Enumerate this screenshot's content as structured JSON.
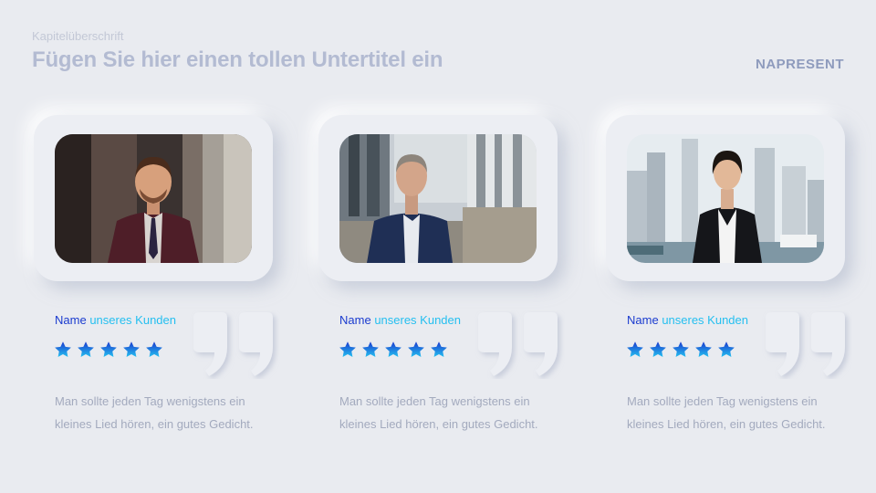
{
  "header": {
    "chapter": "Kapitelüberschrift",
    "subtitle": "Fügen Sie hier einen tollen Untertitel ein",
    "logo": "NAPRESENT"
  },
  "colors": {
    "background": "#e9ebf0",
    "name_primary": "#1a3bcf",
    "name_secondary": "#24bff0",
    "star_gradient_top": "#1a3bcf",
    "star_gradient_bottom": "#24bff0"
  },
  "testimonials": [
    {
      "photo": "man-in-burgundy-suit-office",
      "name_part1": "Name",
      "name_part2": "unseres Kunden",
      "rating": 5,
      "text": "Man sollte jeden Tag wenigstens ein kleines Lied hören, ein gutes Gedicht."
    },
    {
      "photo": "man-in-navy-suit-city",
      "name_part1": "Name",
      "name_part2": "unseres Kunden",
      "rating": 5,
      "text": "Man sollte jeden Tag wenigstens ein kleines Lied hören, ein gutes Gedicht."
    },
    {
      "photo": "woman-in-black-suit-harbor",
      "name_part1": "Name",
      "name_part2": "unseres Kunden",
      "rating": 5,
      "text": "Man sollte jeden Tag wenigstens ein kleines Lied hören, ein gutes Gedicht."
    }
  ]
}
